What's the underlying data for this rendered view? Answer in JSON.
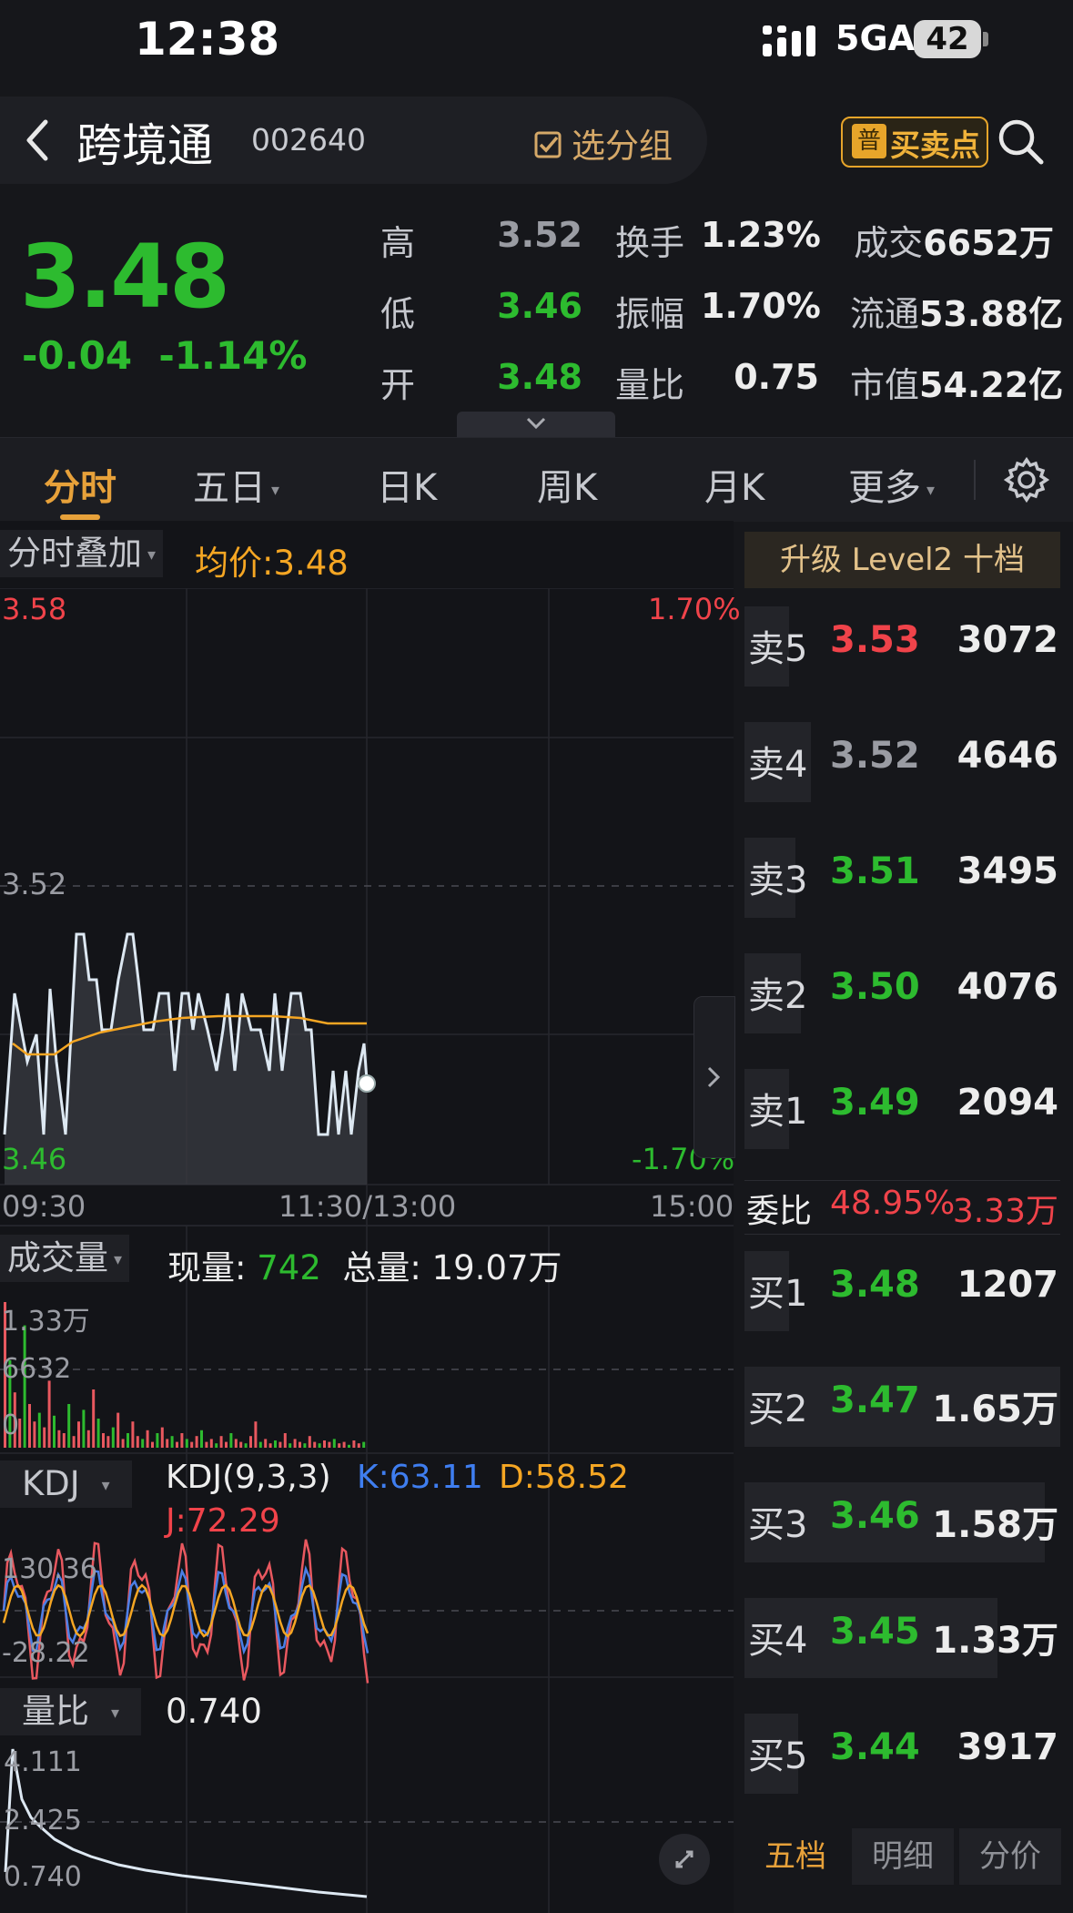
{
  "status_bar": {
    "time": "12:38",
    "network": "5GA",
    "battery": "42"
  },
  "header": {
    "stock_name": "跨境通",
    "stock_code": "002640",
    "group_label": "选分组",
    "buysell_icon": "普",
    "buysell_label": "买卖点"
  },
  "quote": {
    "price": "3.48",
    "change": "-0.04",
    "change_pct": "-1.14%",
    "fields": [
      {
        "label": "高",
        "value": "3.52",
        "color": "#9a9ca3"
      },
      {
        "label": "低",
        "value": "3.46",
        "color": "#2dbb2f"
      },
      {
        "label": "开",
        "value": "3.48",
        "color": "#2dbb2f"
      },
      {
        "label": "换手",
        "value": "1.23%",
        "color": "#ededed"
      },
      {
        "label": "振幅",
        "value": "1.70%",
        "color": "#ededed"
      },
      {
        "label": "量比",
        "value": "0.75",
        "color": "#ededed"
      },
      {
        "label": "成交",
        "value": "6652万"
      },
      {
        "label": "流通",
        "value": "53.88亿"
      },
      {
        "label": "市值",
        "value": "54.22亿"
      }
    ]
  },
  "tabs": [
    "分时",
    "五日",
    "日K",
    "周K",
    "月K",
    "更多"
  ],
  "intraday": {
    "overlay_label": "分时叠加",
    "avg_label": "均价:3.48",
    "price_high": "3.58",
    "price_mid": "3.52",
    "price_low": "3.46",
    "pct_high": "1.70%",
    "pct_low": "-1.70%",
    "time_labels": [
      "09:30",
      "11:30/13:00",
      "15:00"
    ]
  },
  "volume": {
    "label": "成交量",
    "current_label": "现量:",
    "current_value": "742",
    "total_label": "总量:",
    "total_value": "19.07万",
    "axis_top": "1.33万",
    "axis_mid": "6632",
    "axis_bottom": "0"
  },
  "kdj": {
    "label": "KDJ",
    "name": "KDJ(9,3,3)",
    "k": "K:63.11",
    "d": "D:58.52",
    "j": "J:72.29",
    "axis_top": "130.36",
    "axis_bottom": "-28.22"
  },
  "volume_ratio": {
    "label": "量比",
    "value": "0.740",
    "axis_top": "4.111",
    "axis_mid": "2.425",
    "axis_bottom": "0.740"
  },
  "order_book": {
    "level2_label": "升级 Level2 十档",
    "asks": [
      {
        "label": "卖5",
        "price": "3.53",
        "volume": "3072",
        "color": "#f0434a",
        "depth": 0.14
      },
      {
        "label": "卖4",
        "price": "3.52",
        "volume": "4646",
        "color": "#9a9ca3",
        "depth": 0.21
      },
      {
        "label": "卖3",
        "price": "3.51",
        "volume": "3495",
        "color": "#2dbb2f",
        "depth": 0.16
      },
      {
        "label": "卖2",
        "price": "3.50",
        "volume": "4076",
        "color": "#2dbb2f",
        "depth": 0.18
      },
      {
        "label": "卖1",
        "price": "3.49",
        "volume": "2094",
        "color": "#2dbb2f",
        "depth": 0.1
      }
    ],
    "weibi_label": "委比",
    "weibi_pct": "48.95%",
    "weibi_vol": "3.33万",
    "bids": [
      {
        "label": "买1",
        "price": "3.48",
        "volume": "1207",
        "color": "#2dbb2f",
        "depth": 0.06
      },
      {
        "label": "买2",
        "price": "3.47",
        "volume": "1.65万",
        "color": "#2dbb2f",
        "depth": 1.0
      },
      {
        "label": "买3",
        "price": "3.46",
        "volume": "1.58万",
        "color": "#2dbb2f",
        "depth": 0.95
      },
      {
        "label": "买4",
        "price": "3.45",
        "volume": "1.33万",
        "color": "#2dbb2f",
        "depth": 0.8
      },
      {
        "label": "买5",
        "price": "3.44",
        "volume": "3917",
        "color": "#2dbb2f",
        "depth": 0.17
      }
    ],
    "bottom_tabs": [
      "五档",
      "明细",
      "分价"
    ]
  }
}
